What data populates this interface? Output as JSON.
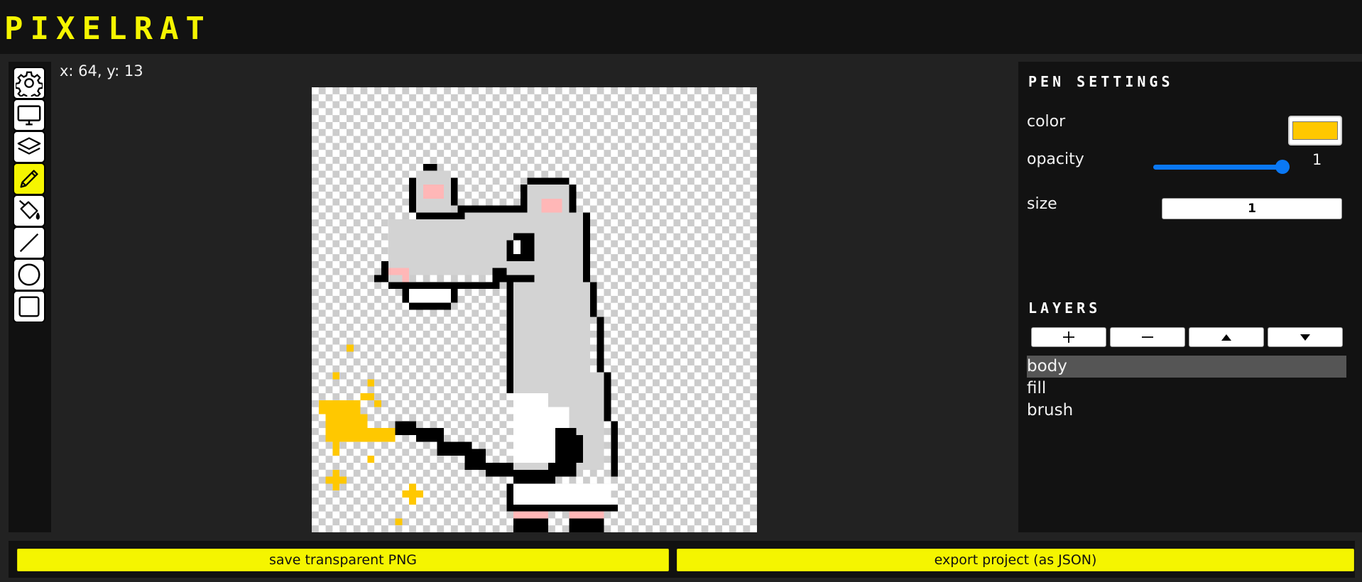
{
  "app": {
    "logo": "PIXELRAT"
  },
  "toolbar": {
    "tools": [
      {
        "name": "settings",
        "icon": "gear-icon"
      },
      {
        "name": "display",
        "icon": "monitor-icon"
      },
      {
        "name": "layers",
        "icon": "layers-icon"
      },
      {
        "name": "pen",
        "icon": "pencil-icon",
        "active": true
      },
      {
        "name": "fill",
        "icon": "paint-bucket-icon"
      },
      {
        "name": "line",
        "icon": "line-icon"
      },
      {
        "name": "circle",
        "icon": "circle-icon"
      },
      {
        "name": "rectangle",
        "icon": "square-icon"
      }
    ],
    "active_color": "#f5f500"
  },
  "cursor": {
    "coords": "x: 64, y: 13"
  },
  "pen_settings": {
    "title": "PEN SETTINGS",
    "color_label": "color",
    "color_value": "#ffc800",
    "opacity_label": "opacity",
    "opacity_value": "1",
    "opacity_fraction": 1,
    "size_label": "size",
    "size_value": "1",
    "slider_color": "#0a78f5"
  },
  "layers": {
    "title": "LAYERS",
    "buttons": [
      {
        "name": "add-layer",
        "icon": "plus-icon"
      },
      {
        "name": "remove-layer",
        "icon": "minus-icon"
      },
      {
        "name": "move-layer-up",
        "icon": "triangle-up-icon"
      },
      {
        "name": "move-layer-down",
        "icon": "triangle-down-icon"
      }
    ],
    "items": [
      {
        "label": "body",
        "selected": true
      },
      {
        "label": "fill",
        "selected": false
      },
      {
        "label": "brush",
        "selected": false
      }
    ]
  },
  "footer": {
    "save_png_label": "save transparent PNG",
    "export_json_label": "export project (as JSON)",
    "button_color": "#f5f500"
  }
}
